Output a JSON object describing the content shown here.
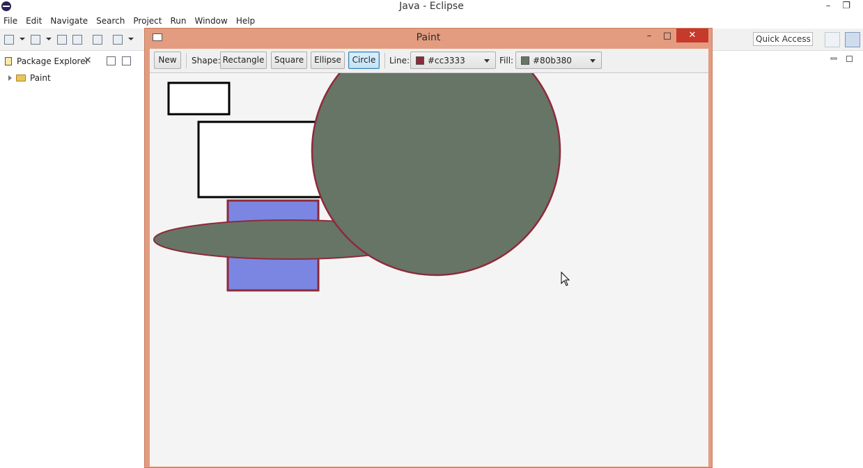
{
  "window": {
    "title": "Java - Eclipse",
    "minimize": "–",
    "restore": "❐"
  },
  "menu": [
    "File",
    "Edit",
    "Navigate",
    "Search",
    "Project",
    "Run",
    "Window",
    "Help"
  ],
  "toolbar": {
    "quick_access": "Quick Access"
  },
  "package_explorer": {
    "tab_label": "Package Explorer",
    "close": "✕",
    "items": [
      {
        "label": "Paint",
        "expanded": false
      }
    ]
  },
  "paint": {
    "title": "Paint",
    "minimize": "–",
    "maximize": "□",
    "close": "✕",
    "buttons": {
      "new": "New",
      "rectangle": "Rectangle",
      "square": "Square",
      "ellipse": "Ellipse",
      "circle": "Circle"
    },
    "selected_shape": "Circle",
    "shape_label": "Shape:",
    "line_label": "Line:",
    "fill_label": "Fill:",
    "line_color": "#cc3333",
    "fill_color": "#80b380",
    "line_swatch": "#8e2a3a",
    "fill_swatch": "#677566",
    "shapes": [
      {
        "type": "rectangle",
        "stroke": "#000000",
        "fill": "#ffffff"
      },
      {
        "type": "rectangle",
        "stroke": "#000000",
        "fill": "#ffffff"
      },
      {
        "type": "rectangle",
        "stroke": "#8e2a3a",
        "fill": "#7b86e2"
      },
      {
        "type": "ellipse",
        "stroke": "#8e2a3a",
        "fill": "#677566"
      },
      {
        "type": "circle",
        "stroke": "#8e2a3a",
        "fill": "#677566"
      }
    ]
  }
}
